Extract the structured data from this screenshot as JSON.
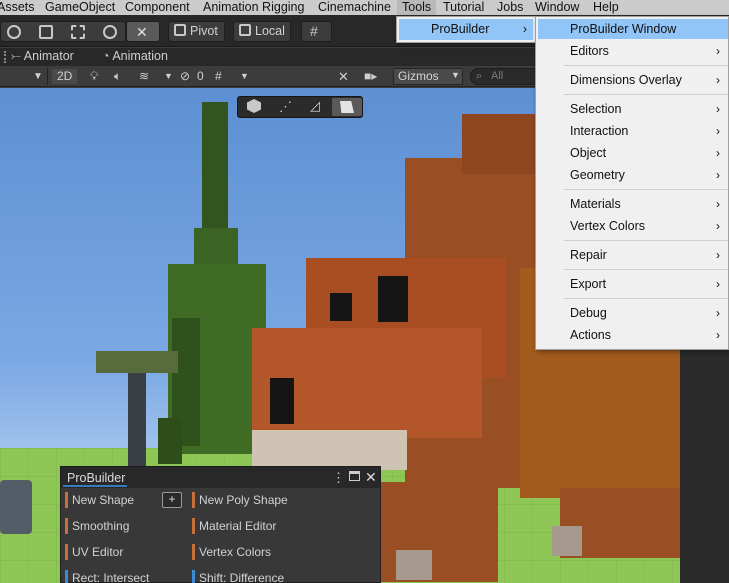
{
  "menubar": {
    "items": [
      "Assets",
      "GameObject",
      "Component",
      "Animation Rigging",
      "Cinemachine",
      "Tools",
      "Tutorial",
      "Jobs",
      "Window",
      "Help"
    ]
  },
  "toolbar": {
    "pivot_label": "Pivot",
    "local_label": "Local"
  },
  "tabs": {
    "animator": "Animator",
    "animation": "Animation"
  },
  "scene_toolbar": {
    "mode_2d": "2D",
    "hidden_count": "0",
    "gizmos_label": "Gizmos",
    "search_placeholder": "All"
  },
  "tools_menu": {
    "probuilder_label": "ProBuilder",
    "arrow": "›"
  },
  "probuilder_submenu": {
    "items": [
      {
        "label": "ProBuilder Window",
        "arrow": ""
      },
      {
        "label": "Editors",
        "arrow": "›"
      },
      {
        "label": "Dimensions Overlay",
        "arrow": "›"
      },
      {
        "label": "Selection",
        "arrow": "›"
      },
      {
        "label": "Interaction",
        "arrow": "›"
      },
      {
        "label": "Object",
        "arrow": "›"
      },
      {
        "label": "Geometry",
        "arrow": "›"
      },
      {
        "label": "Materials",
        "arrow": "›"
      },
      {
        "label": "Vertex Colors",
        "arrow": "›"
      },
      {
        "label": "Repair",
        "arrow": "›"
      },
      {
        "label": "Export",
        "arrow": "›"
      },
      {
        "label": "Debug",
        "arrow": "›"
      },
      {
        "label": "Actions",
        "arrow": "›"
      }
    ]
  },
  "probuilder_window": {
    "title": "ProBuilder",
    "plus": "+",
    "left_items": [
      "New Shape",
      "Smoothing",
      "UV Editor",
      "Rect: Intersect"
    ],
    "right_items": [
      "New Poly Shape",
      "Material Editor",
      "Vertex Colors",
      "Shift: Difference"
    ]
  },
  "colors": {
    "highlight": "#91c5f7",
    "menu_bg": "#f0f0f0",
    "editor_dark": "#282828",
    "accent_orange": "#c8703c",
    "accent_blue": "#3a8ad8"
  }
}
